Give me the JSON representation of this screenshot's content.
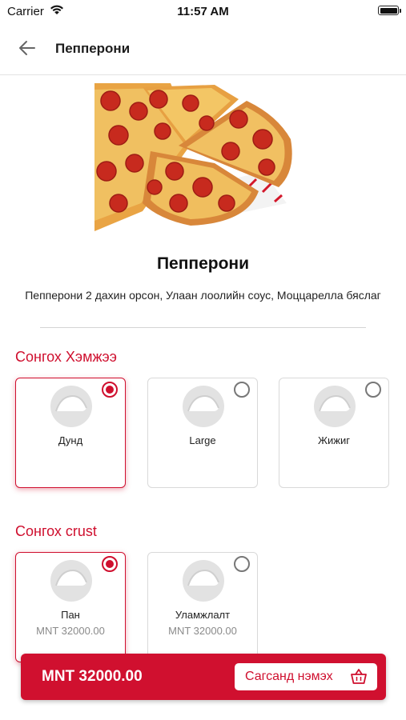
{
  "status_bar": {
    "carrier": "Carrier",
    "time": "11:57 AM"
  },
  "nav": {
    "title": "Пепперони",
    "back_icon": "arrow-left-icon"
  },
  "product": {
    "title": "Пепперони",
    "description": "Пепперони 2 дахин орсон, Улаан лоолийн соус, Моццарелла бяслаг"
  },
  "size_section": {
    "title": "Сонгох Хэмжээ",
    "options": [
      {
        "label": "Дунд",
        "selected": true
      },
      {
        "label": "Large",
        "selected": false
      },
      {
        "label": "Жижиг",
        "selected": false
      }
    ]
  },
  "crust_section": {
    "title": "Сонгох crust",
    "options": [
      {
        "label": "Пан",
        "price": "MNT 32000.00",
        "selected": true
      },
      {
        "label": "Уламжлалт",
        "price": "MNT 32000.00",
        "selected": false
      }
    ]
  },
  "bottom_bar": {
    "total": "MNT 32000.00",
    "add_button": "Сагсанд нэмэх",
    "icon": "basket-icon"
  },
  "colors": {
    "accent": "#cf0f2e",
    "bar": "#d0102f"
  }
}
